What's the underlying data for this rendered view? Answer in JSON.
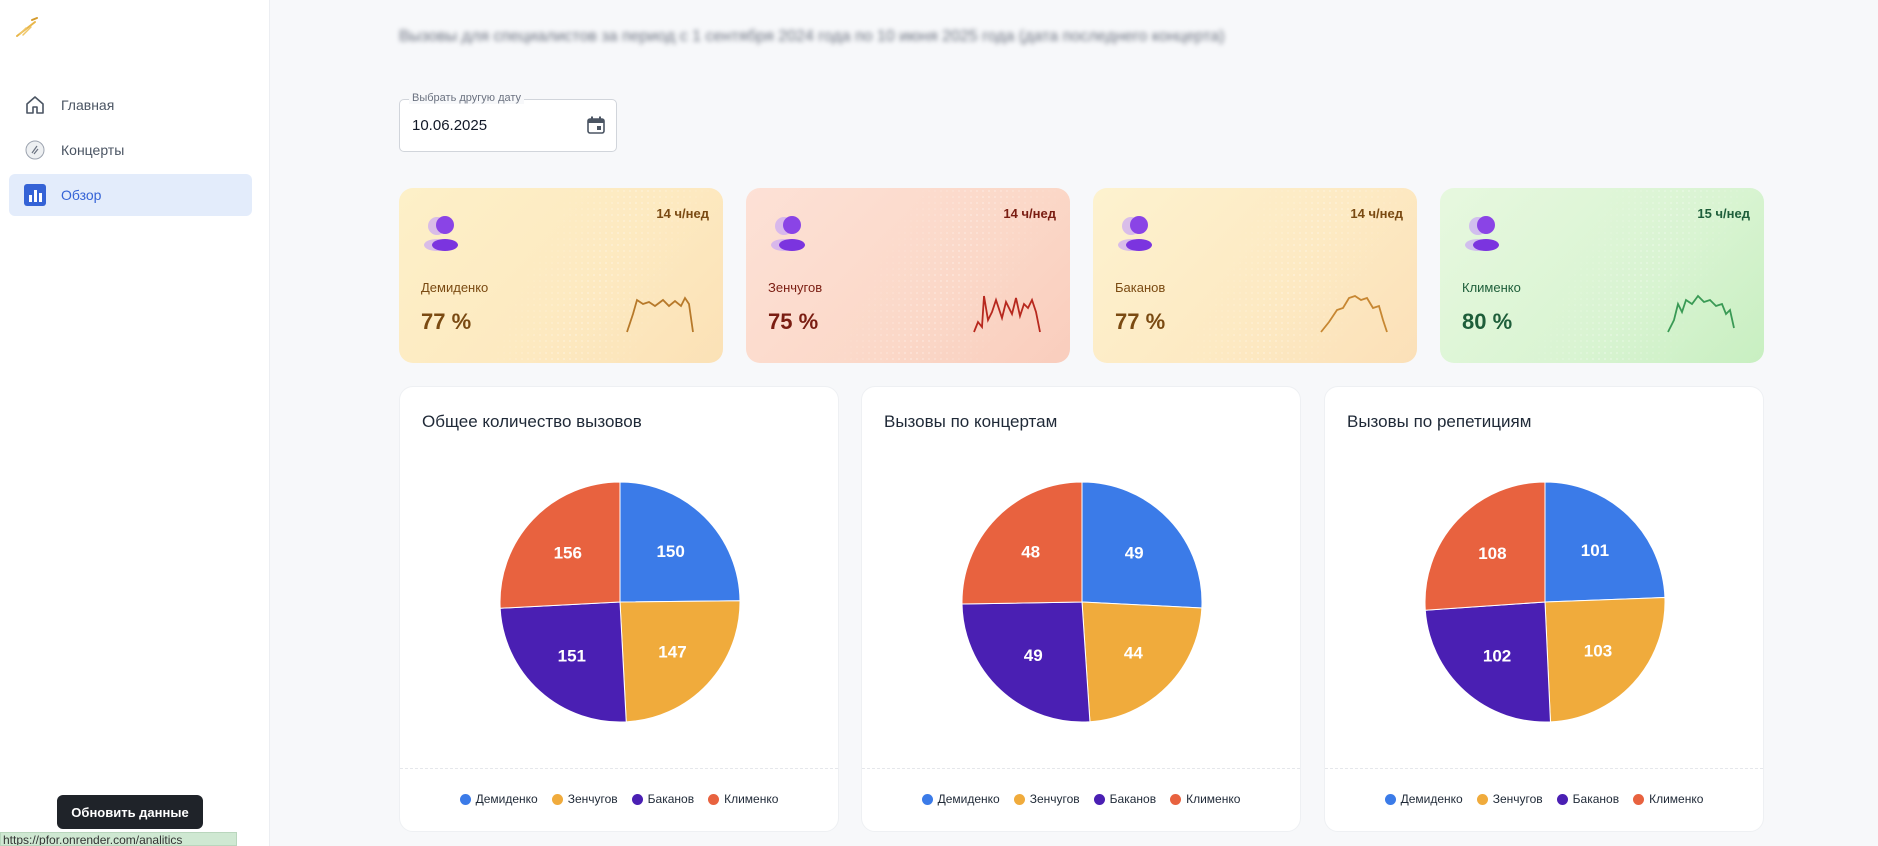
{
  "header": {
    "blurred_text": "Вызовы для специалистов за период с 1 сентября 2024 года по 10 июня 2025 года (дата последнего концерта)"
  },
  "sidebar": {
    "items": [
      {
        "label": "Главная",
        "icon": "home-icon",
        "active": false
      },
      {
        "label": "Концерты",
        "icon": "concert-icon",
        "active": false
      },
      {
        "label": "Обзор",
        "icon": "bar-chart-icon",
        "active": true
      }
    ],
    "refresh_label": "Обновить данные",
    "status_url": "https://pfor.onrender.com/analitics"
  },
  "date_picker": {
    "label": "Выбрать другую дату",
    "value": "10.06.2025"
  },
  "stats": [
    {
      "name": "Демиденко",
      "hours": "14 ч/нед",
      "value": "77 %",
      "text_color": "#7a4a12",
      "line_color": "#b7792a"
    },
    {
      "name": "Зенчугов",
      "hours": "14 ч/нед",
      "value": "75 %",
      "text_color": "#7a1d12",
      "line_color": "#b7281e"
    },
    {
      "name": "Баканов",
      "hours": "14 ч/нед",
      "value": "77 %",
      "text_color": "#7a4a12",
      "line_color": "#c78732"
    },
    {
      "name": "Клименко",
      "hours": "15 ч/нед",
      "value": "80 %",
      "text_color": "#1e5e3a",
      "line_color": "#3a9a55"
    }
  ],
  "legend": [
    "Демиденко",
    "Зенчугов",
    "Баканов",
    "Клименко"
  ],
  "colors": {
    "series": [
      "#3b7be8",
      "#f0ab3c",
      "#4a1fb3",
      "#e8623f"
    ],
    "accent": "#3563d6"
  },
  "chart_data": [
    {
      "type": "pie",
      "title": "Общее количество вызовов",
      "categories": [
        "Демиденко",
        "Зенчугов",
        "Баканов",
        "Клименко"
      ],
      "values": [
        150,
        147,
        151,
        156
      ]
    },
    {
      "type": "pie",
      "title": "Вызовы по концертам",
      "categories": [
        "Демиденко",
        "Зенчугов",
        "Баканов",
        "Клименко"
      ],
      "values": [
        49,
        44,
        49,
        48
      ]
    },
    {
      "type": "pie",
      "title": "Вызовы по репетициям",
      "categories": [
        "Демиденко",
        "Зенчугов",
        "Баканов",
        "Клименко"
      ],
      "values": [
        101,
        103,
        102,
        108
      ]
    }
  ]
}
